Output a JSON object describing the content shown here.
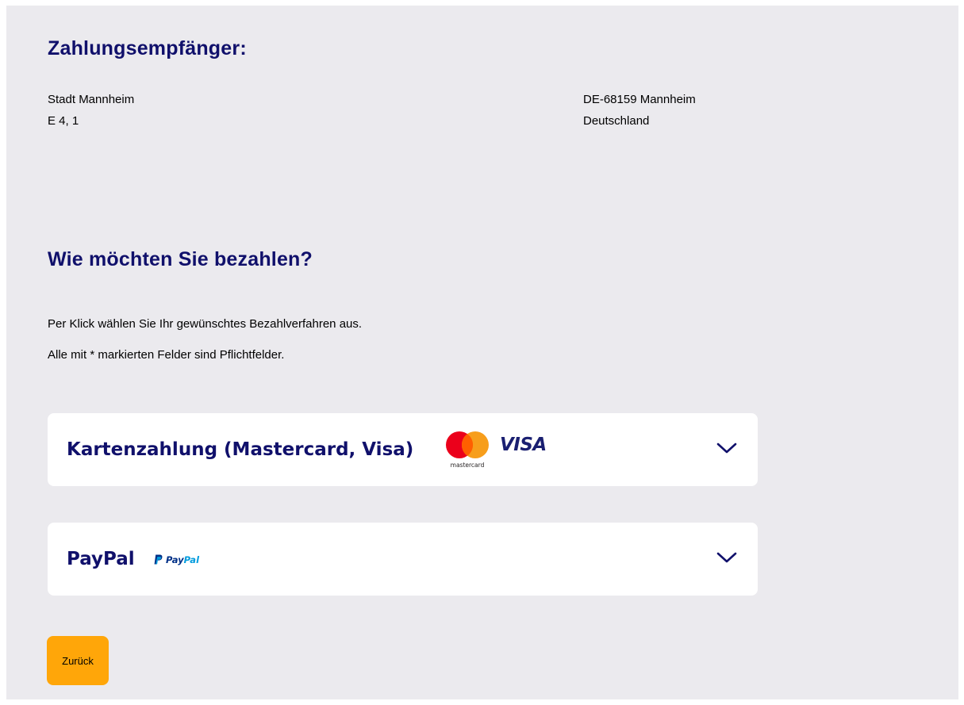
{
  "recipient": {
    "heading": "Zahlungsempfänger:",
    "name": "Stadt Mannheim",
    "street": "E 4, 1",
    "city": "DE-68159 Mannheim",
    "country": "Deutschland"
  },
  "payment": {
    "heading": "Wie möchten Sie bezahlen?",
    "instruction": "Per Klick wählen Sie Ihr gewünschtes Bezahlverfahren aus.",
    "required_note": "Alle mit * markierten Felder sind Pflichtfelder.",
    "options": [
      {
        "label": "Kartenzahlung (Mastercard, Visa)",
        "logos": [
          "mastercard-logo",
          "visa-logo"
        ],
        "mastercard_text": "mastercard",
        "visa_text": "VISA",
        "expanded": false
      },
      {
        "label": "PayPal",
        "logos": [
          "paypal-logo"
        ],
        "paypal_text_a": "Pay",
        "paypal_text_b": "Pal",
        "expanded": false
      }
    ]
  },
  "actions": {
    "back_label": "Zurück"
  },
  "colors": {
    "heading": "#10106b",
    "background": "#ebeaee",
    "card": "#ffffff",
    "back_button": "#ffa609",
    "mastercard_red": "#eb001b",
    "mastercard_orange": "#f79e1b",
    "visa_blue": "#1a1f71",
    "paypal_dark": "#003087",
    "paypal_light": "#009cde"
  }
}
